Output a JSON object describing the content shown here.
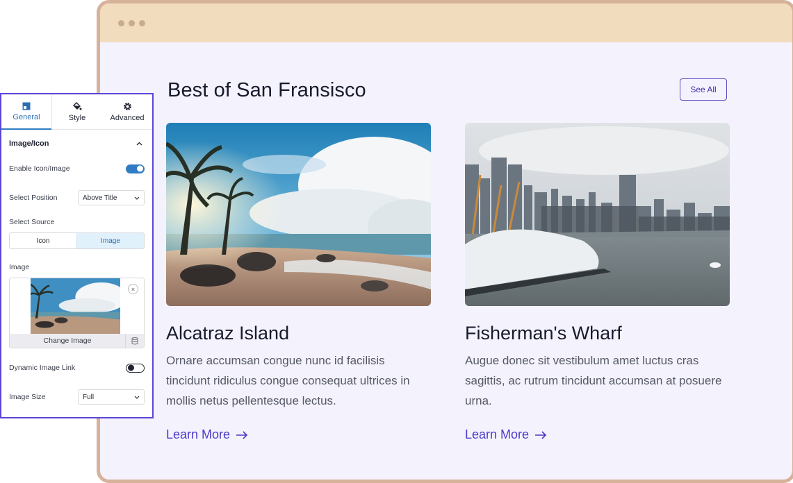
{
  "browser": {
    "page_title": "Best of San Fransisco",
    "see_all_label": "See All",
    "cards": [
      {
        "title": "Alcatraz Island",
        "description": "Ornare accumsan congue nunc id facilisis tincidunt ridiculus congue consequat ultrices in mollis netus pellentesque lectus.",
        "link_label": "Learn More",
        "image": "tropical beach with palm trees, rocks and cloudy sky"
      },
      {
        "title": "Fisherman's Wharf",
        "description": "Augue donec sit vestibulum amet luctus cras sagittis, ac rutrum tincidunt accumsan at posuere urna.",
        "link_label": "Learn More",
        "image": "city skyline with river and white domed building"
      }
    ]
  },
  "panel": {
    "tabs": [
      {
        "label": "General",
        "icon": "layout-icon",
        "active": true
      },
      {
        "label": "Style",
        "icon": "paint-bucket-icon",
        "active": false
      },
      {
        "label": "Advanced",
        "icon": "gear-icon",
        "active": false
      }
    ],
    "section_title": "Image/Icon",
    "enable_label": "Enable Icon/Image",
    "enable_on": true,
    "position_label": "Select Position",
    "position_value": "Above Title",
    "source_label": "Select Source",
    "source_options": [
      "Icon",
      "Image"
    ],
    "source_selected": "Image",
    "image_label": "Image",
    "change_image_label": "Change Image",
    "dynamic_link_label": "Dynamic Image Link",
    "dynamic_link_on": false,
    "size_label": "Image Size",
    "size_value": "Full"
  },
  "colors": {
    "accent": "#4c3bc8",
    "panel_border": "#5a46d6",
    "toggle_on": "#2f7cc4",
    "frame": "#d6b29a",
    "frame_top": "#f1dcbd"
  }
}
